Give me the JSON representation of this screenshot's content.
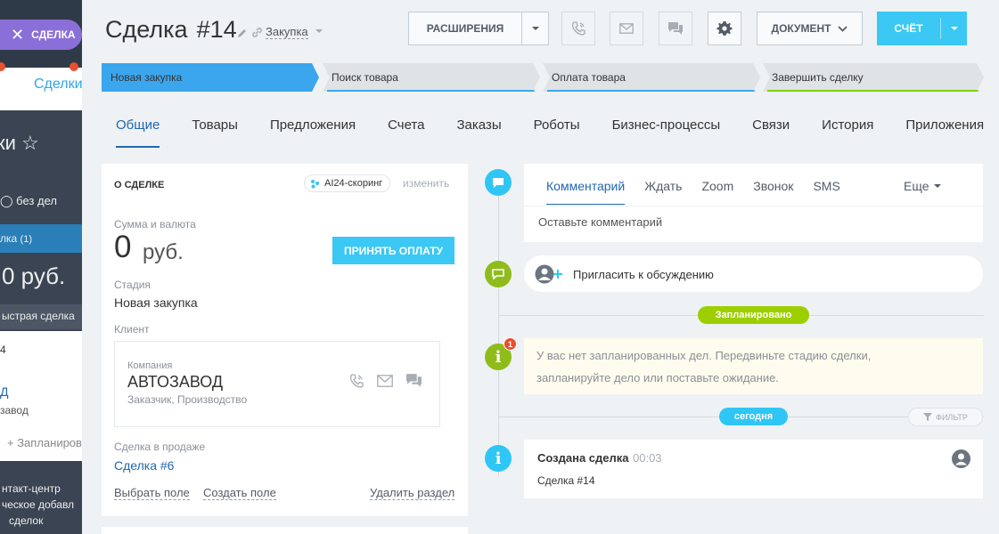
{
  "background": {
    "close_label": "СДЕЛКА",
    "tab": "Сделки",
    "title_frag": "ки",
    "no_tasks": "без дел",
    "stage_item": "лка",
    "stage_count": "(1)",
    "sum": "0 руб.",
    "quick": "ыстрая сделка",
    "n4": "4",
    "d": "Д",
    "zavod": "завод",
    "plan": "+ Запланиров",
    "cc1": "нтакт-центр",
    "cc2": "ческое добавл",
    "cc3": "сделок"
  },
  "header": {
    "title": "Сделка",
    "number": "#14",
    "category": "Закупка",
    "extensions": "РАСШИРЕНИЯ",
    "document": "ДОКУМЕНТ",
    "invoice": "СЧЁТ"
  },
  "stages": [
    {
      "label": "Новая закупка",
      "color": "#39a8ef"
    },
    {
      "label": "Поиск товара",
      "color": "#39a8ef"
    },
    {
      "label": "Оплата товара",
      "color": "#39a8ef"
    },
    {
      "label": "Завершить сделку",
      "color": "#7bd500"
    }
  ],
  "tabs": [
    "Общие",
    "Товары",
    "Предложения",
    "Счета",
    "Заказы",
    "Роботы",
    "Бизнес-процессы",
    "Связи",
    "История",
    "Приложения"
  ],
  "about": {
    "heading": "О СДЕЛКЕ",
    "ai": "AI24-скоринг",
    "change": "изменить",
    "sum_label": "Сумма и валюта",
    "sum_value": "0",
    "currency": "руб.",
    "pay_button": "ПРИНЯТЬ ОПЛАТУ",
    "stage_label": "Стадия",
    "stage_value": "Новая закупка",
    "client_label": "Клиент",
    "company_type": "Компания",
    "company_name": "АВТОЗАВОД",
    "company_desc": "Заказчик, Производство",
    "sale_label": "Сделка в продаже",
    "sale_link": "Сделка #6",
    "select_field": "Выбрать поле",
    "create_field": "Создать поле",
    "delete_section": "Удалить раздел"
  },
  "timeline": {
    "comment_tabs": [
      "Комментарий",
      "Ждать",
      "Zoom",
      "Звонок",
      "SMS"
    ],
    "more": "Еще",
    "comment_placeholder": "Оставьте комментарий",
    "invite": "Пригласить к обсуждению",
    "planned": "Запланировано",
    "badge_count": "1",
    "note_line1": "У вас нет запланированных дел. Передвиньте стадию сделки,",
    "note_line2": "запланируйте дело или поставьте ожидание.",
    "today": "сегодня",
    "filter": "ФИЛЬТР",
    "created_title": "Создана сделка",
    "created_time": "00:03",
    "created_sub": "Сделка #14"
  }
}
